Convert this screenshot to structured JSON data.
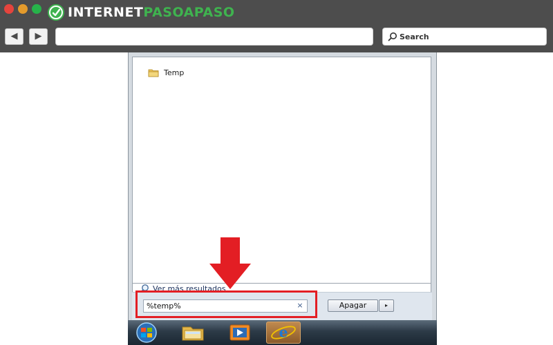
{
  "browser": {
    "logo": {
      "text_white": "INTERNET",
      "text_green": "PASOAPASO",
      "accent": "#3fb34f"
    },
    "traffic_lights": [
      "#e5443d",
      "#e49b2c",
      "#27b34a"
    ],
    "back_label": "◀",
    "forward_label": "▶",
    "search_placeholder": "Search",
    "search_icon": "search-icon"
  },
  "start_menu": {
    "results": [
      {
        "label": "Temp",
        "icon": "folder-icon"
      }
    ],
    "more_results_label": "Ver más resultados",
    "search_value": "%temp%",
    "clear_label": "×",
    "shutdown_label": "Apagar",
    "shutdown_arrow_label": "▸"
  },
  "annotation": {
    "highlight_color": "#e31e24"
  },
  "taskbar": {
    "items": [
      "start-orb-icon",
      "file-explorer-icon",
      "media-player-icon",
      "internet-explorer-icon"
    ]
  }
}
